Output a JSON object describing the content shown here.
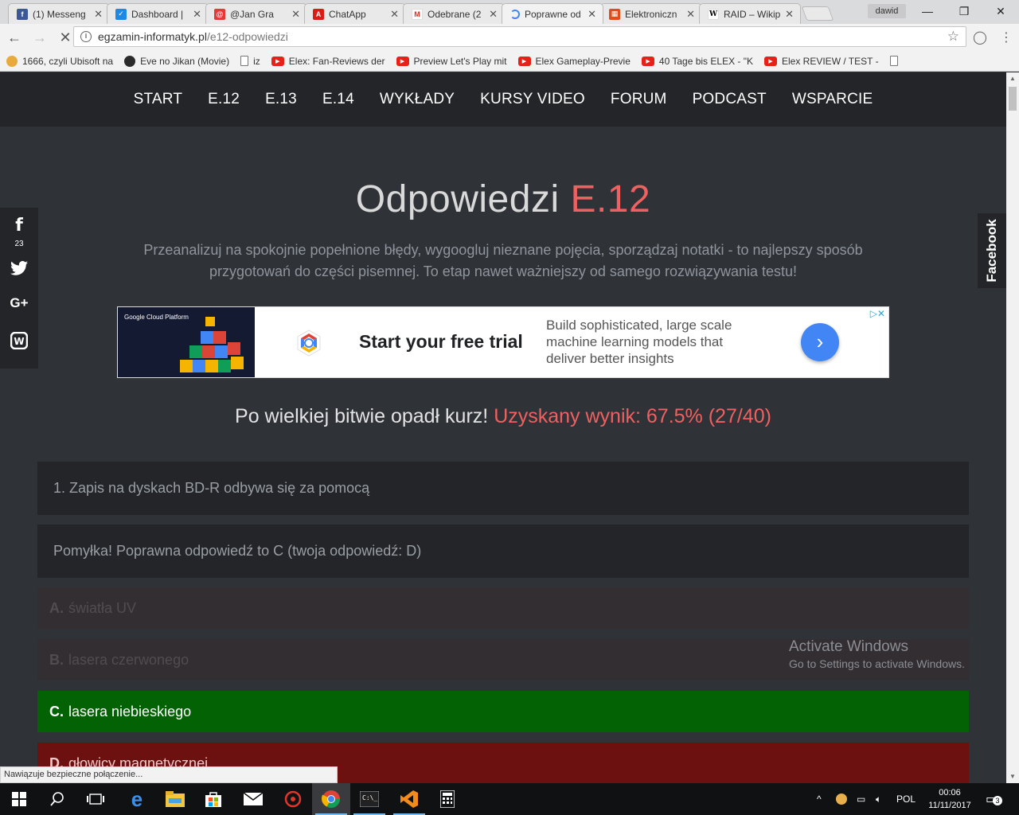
{
  "browser": {
    "tabs": [
      {
        "title": "(1) Messeng",
        "fav_color": "#3b5998",
        "fav_glyph": "f",
        "icon": "facebook-icon"
      },
      {
        "title": "Dashboard |",
        "fav_color": "#1e88e5",
        "fav_glyph": "✓",
        "icon": "check-icon"
      },
      {
        "title": "@Jan Gra",
        "fav_color": "#e53935",
        "fav_glyph": "@",
        "icon": "mail-icon"
      },
      {
        "title": "ChatApp",
        "fav_color": "#dd1b16",
        "fav_glyph": "A",
        "icon": "angular-icon"
      },
      {
        "title": "Odebrane (2",
        "fav_color": "#ffffff",
        "fav_glyph": "M",
        "icon": "gmail-icon"
      },
      {
        "title": "Poprawne od",
        "fav_color": "#f2f2f2",
        "fav_glyph": "",
        "icon": "loading-icon"
      },
      {
        "title": "Elektroniczn",
        "fav_color": "#e64a19",
        "fav_glyph": "▦",
        "icon": "site-icon"
      },
      {
        "title": "RAID – Wikip",
        "fav_color": "#ffffff",
        "fav_glyph": "W",
        "icon": "wikipedia-icon"
      }
    ],
    "active_tab": 5,
    "profile_name": "dawid",
    "url_host": "egzamin-informatyk.pl",
    "url_path": "/e12-odpowiedzi",
    "bookmarks": [
      {
        "label": "1666, czyli Ubisoft na",
        "type": "sun"
      },
      {
        "label": "Eve no Jikan (Movie)",
        "type": "eye"
      },
      {
        "label": "iz",
        "type": "doc"
      },
      {
        "label": "Elex: Fan-Reviews der",
        "type": "yt"
      },
      {
        "label": "Preview Let's Play mit",
        "type": "yt"
      },
      {
        "label": "Elex Gameplay-Previe",
        "type": "yt"
      },
      {
        "label": "40 Tage bis ELEX - \"K",
        "type": "yt"
      },
      {
        "label": "Elex REVIEW / TEST -",
        "type": "yt"
      },
      {
        "label": "",
        "type": "doc"
      }
    ],
    "status_text": "Nawiązuje bezpieczne połączenie..."
  },
  "site": {
    "nav": [
      "START",
      "E.12",
      "E.13",
      "E.14",
      "WYKŁADY",
      "KURSY VIDEO",
      "FORUM",
      "PODCAST",
      "WSPARCIE"
    ],
    "heading_main": "Odpowiedzi",
    "heading_accent": "E.12",
    "lead": "Przeanalizuj na spokojnie popełnione błędy, wygoogluj nieznane pojęcia, sporządzaj notatki - to najlepszy sposób przygotowań do części pisemnej. To etap nawet ważniejszy od samego rozwiązywania testu!",
    "social_fb_count": "23",
    "facebook_tab": "Facebook",
    "result_text": "Po wielkiej bitwie opadł kurz!",
    "result_score": "Uzyskany wynik: 67.5% (27/40)",
    "question": "1. Zapis na dyskach BD-R odbywa się za pomocą",
    "feedback": "Pomyłka! Poprawna odpowiedź to C (twoja odpowiedź: D)",
    "answers": [
      {
        "letter": "A.",
        "text": "światła UV",
        "state": "muted"
      },
      {
        "letter": "B.",
        "text": "lasera czerwonego",
        "state": "muted"
      },
      {
        "letter": "C.",
        "text": "lasera niebieskiego",
        "state": "correct"
      },
      {
        "letter": "D.",
        "text": "głowicy magnetycznej",
        "state": "wrong"
      }
    ],
    "accent_color": "#f06060"
  },
  "ad": {
    "platform": "Google Cloud Platform",
    "cta": "Start your free trial",
    "description": "Build sophisticated, large scale machine learning models that deliver better insights",
    "button_glyph": "›"
  },
  "watermark": {
    "title": "Activate Windows",
    "subtitle": "Go to Settings to activate Windows."
  },
  "taskbar": {
    "language": "POL",
    "time": "00:06",
    "date": "11/11/2017",
    "notifications": "3"
  }
}
